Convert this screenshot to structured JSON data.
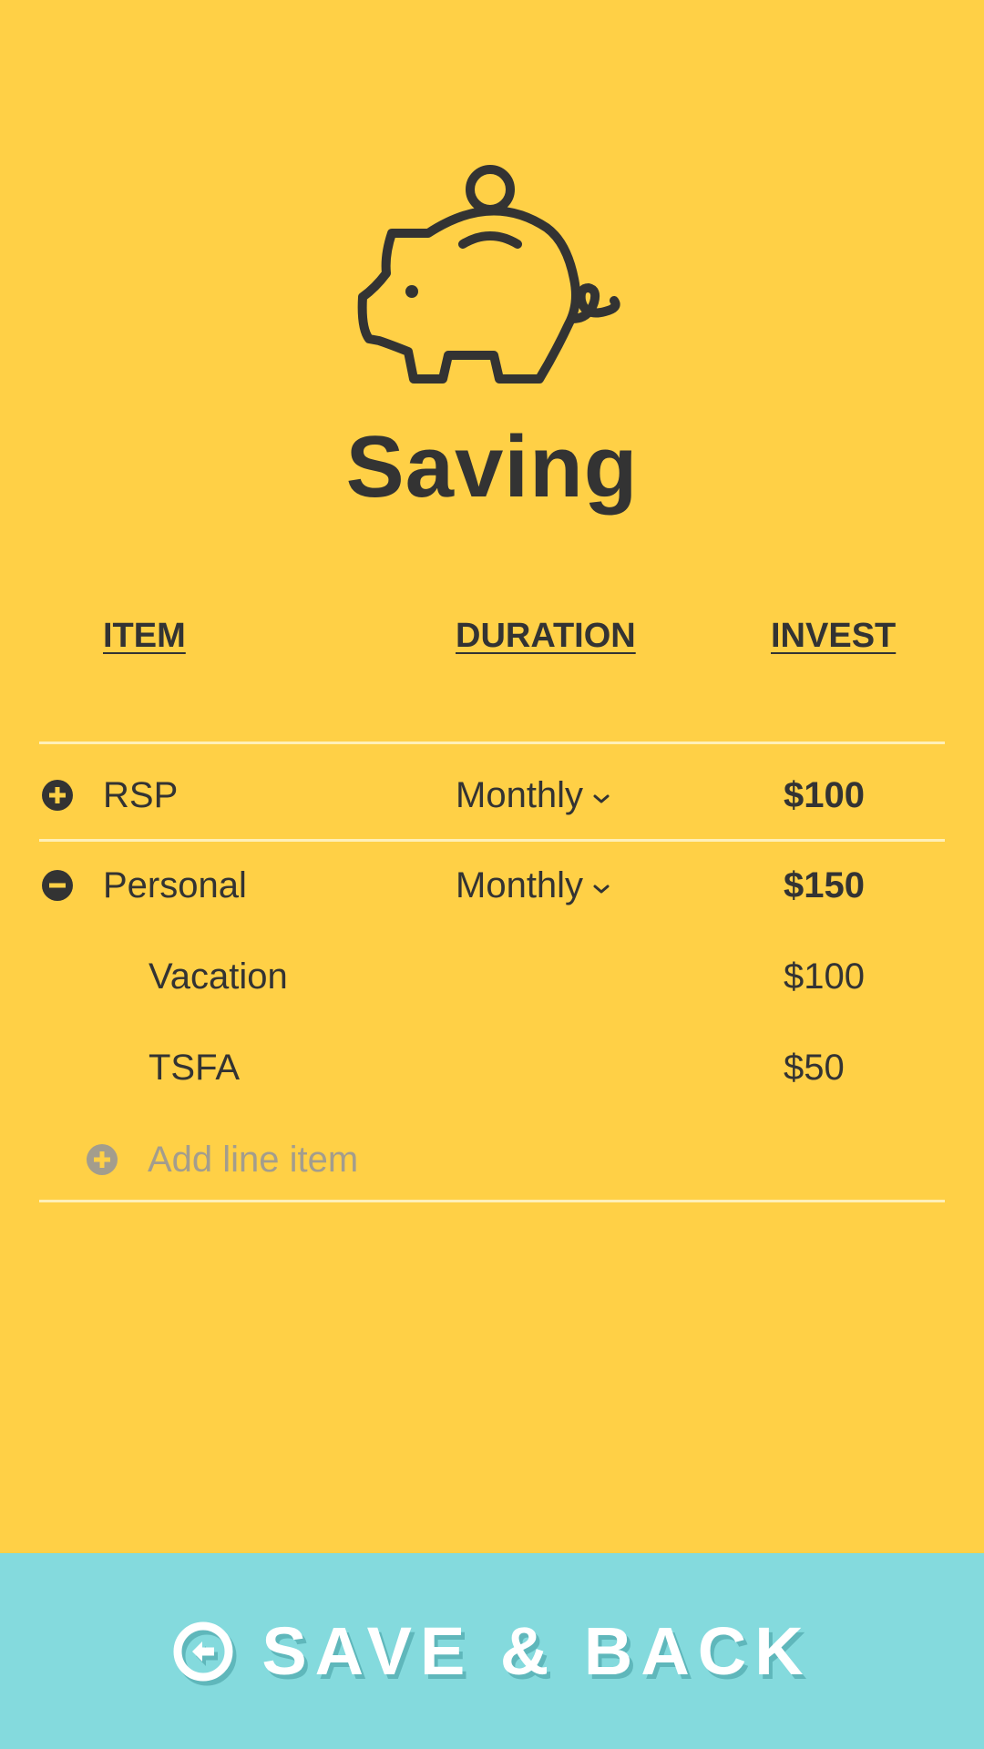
{
  "title": "Saving",
  "icon": "piggy-bank-icon",
  "colors": {
    "background": "#FFD046",
    "text": "#333333",
    "divider": "#FFF0B8",
    "muted": "#A39D8D",
    "footer": "#84DADD",
    "footer_text": "#FFFFFF"
  },
  "table": {
    "headers": {
      "item": "ITEM",
      "duration": "DURATION",
      "invest": "INVEST"
    },
    "rows": [
      {
        "toggle_icon": "plus-circle-icon",
        "item": "RSP",
        "duration": "Monthly",
        "invest": "$100"
      },
      {
        "toggle_icon": "minus-circle-icon",
        "item": "Personal",
        "duration": "Monthly",
        "invest": "$150",
        "sub_items": [
          {
            "item": "Vacation",
            "invest": "$100"
          },
          {
            "item": "TSFA",
            "invest": "$50"
          }
        ]
      }
    ],
    "add_line_label": "Add line item"
  },
  "footer": {
    "button_label": "SAVE & BACK",
    "button_icon": "back-arrow-circle-icon"
  }
}
